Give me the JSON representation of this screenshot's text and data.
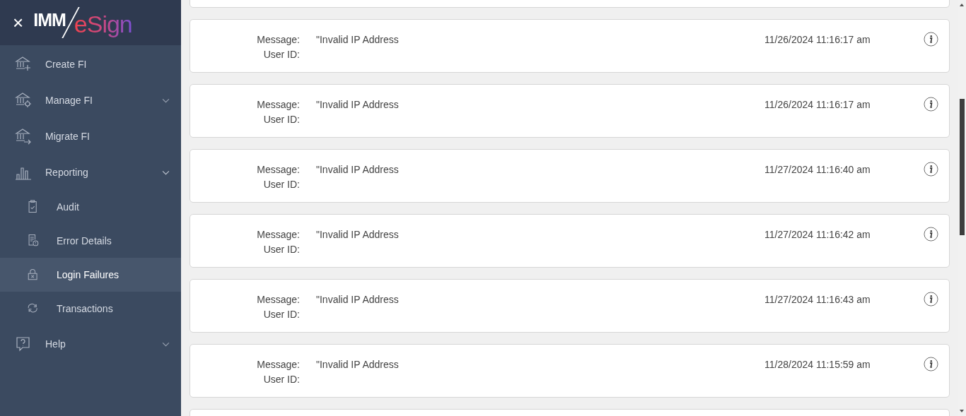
{
  "sidebar": {
    "close_icon": "×",
    "logo": {
      "part_1": "IMM",
      "part_2": "eSign"
    },
    "items": [
      {
        "kind": "link",
        "label": "Create FI",
        "selected": false
      },
      {
        "kind": "group",
        "label": "Manage FI",
        "selected": false
      },
      {
        "kind": "link",
        "label": "Migrate FI",
        "selected": false
      },
      {
        "kind": "group",
        "label": "Reporting",
        "selected": false,
        "expanded": true,
        "children": [
          {
            "label": "Audit",
            "selected": false
          },
          {
            "label": "Error Details",
            "selected": false
          },
          {
            "label": "Login Failures",
            "selected": true
          },
          {
            "label": "Transactions",
            "selected": false
          }
        ]
      },
      {
        "kind": "group",
        "label": "Help",
        "selected": false
      }
    ]
  },
  "entries": [
    {
      "message_label": "Message:",
      "message": "\"Invalid IP Address",
      "user_label": "User ID:",
      "timestamp": "11/26/2024 11:16:17 am"
    },
    {
      "message_label": "Message:",
      "message": "\"Invalid IP Address",
      "user_label": "User ID:",
      "timestamp": "11/26/2024 11:16:17 am"
    },
    {
      "message_label": "Message:",
      "message": "\"Invalid IP Address",
      "user_label": "User ID:",
      "timestamp": "11/27/2024 11:16:40 am"
    },
    {
      "message_label": "Message:",
      "message": "\"Invalid IP Address",
      "user_label": "User ID:",
      "timestamp": "11/27/2024 11:16:42 am"
    },
    {
      "message_label": "Message:",
      "message": "\"Invalid IP Address",
      "user_label": "User ID:",
      "timestamp": "11/27/2024 11:16:43 am"
    },
    {
      "message_label": "Message:",
      "message": "\"Invalid IP Address",
      "user_label": "User ID:",
      "timestamp": "11/28/2024 11:15:59 am"
    }
  ]
}
